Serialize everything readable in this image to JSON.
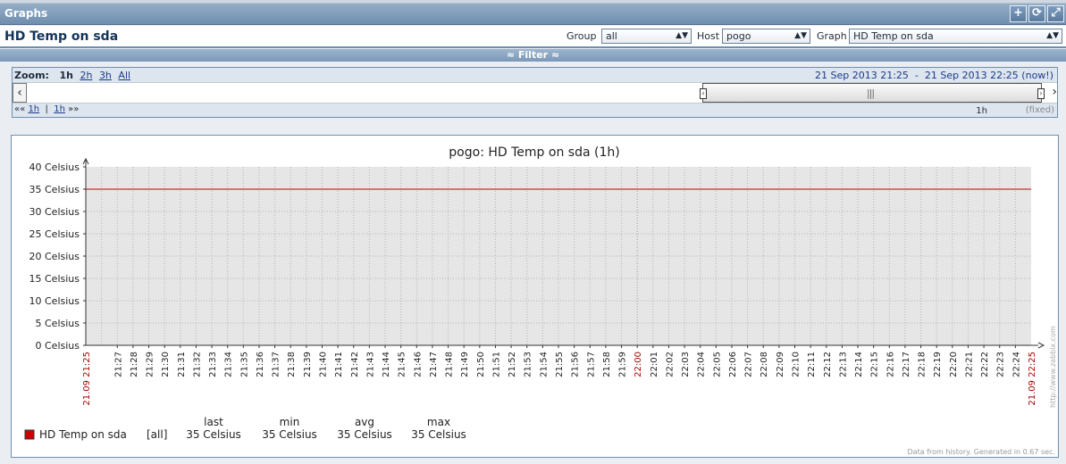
{
  "header": {
    "title": "Graphs",
    "buttons": [
      {
        "name": "add-to-favourites-icon",
        "glyph": "+"
      },
      {
        "name": "refresh-icon",
        "glyph": "⟳"
      },
      {
        "name": "fullscreen-icon",
        "glyph": "⤢"
      }
    ]
  },
  "page_title": "HD Temp on sda",
  "filters": {
    "group_label": "Group",
    "group_value": "all",
    "host_label": "Host",
    "host_value": "pogo",
    "graph_label": "Graph",
    "graph_value": "HD Temp on sda"
  },
  "filter_bar": {
    "label": "Filter",
    "arrow": "≈"
  },
  "zoom": {
    "label": "Zoom:",
    "options": [
      "1h",
      "2h",
      "3h",
      "All"
    ],
    "selected": "1h",
    "range_start": "21 Sep 2013 21:25",
    "range_sep": "-",
    "range_end": "21 Sep 2013 22:25 (now!)",
    "nav_back": "««",
    "nav_back_step": "1h",
    "nav_sep": "|",
    "nav_fwd_step": "1h",
    "nav_fwd": "»»",
    "period": "1h",
    "fixed": "(fixed)"
  },
  "chart_data": {
    "type": "line",
    "title": "pogo: HD Temp on sda (1h)",
    "ylim": [
      0,
      40
    ],
    "y_ticks": [
      "0 Celsius",
      "5 Celsius",
      "10 Celsius",
      "15 Celsius",
      "20 Celsius",
      "25 Celsius",
      "30 Celsius",
      "35 Celsius",
      "40 Celsius"
    ],
    "y_tick_values": [
      0,
      5,
      10,
      15,
      20,
      25,
      30,
      35,
      40
    ],
    "x_start_label": "21.09 21:25",
    "x_end_label": "21.09 22:25",
    "x_minute_labels": [
      "21:27",
      "21:28",
      "21:29",
      "21:30",
      "21:31",
      "21:32",
      "21:33",
      "21:34",
      "21:35",
      "21:36",
      "21:37",
      "21:38",
      "21:39",
      "21:40",
      "21:41",
      "21:42",
      "21:43",
      "21:44",
      "21:45",
      "21:46",
      "21:47",
      "21:48",
      "21:49",
      "21:50",
      "21:51",
      "21:52",
      "21:53",
      "21:54",
      "21:55",
      "21:56",
      "21:57",
      "21:58",
      "21:59",
      "22:00",
      "22:01",
      "22:02",
      "22:03",
      "22:04",
      "22:05",
      "22:06",
      "22:07",
      "22:08",
      "22:09",
      "22:10",
      "22:11",
      "22:12",
      "22:13",
      "22:14",
      "22:15",
      "22:16",
      "22:17",
      "22:18",
      "22:19",
      "22:20",
      "22:21",
      "22:22",
      "22:23",
      "22:24"
    ],
    "series": [
      {
        "name": "HD Temp on sda",
        "color": "#cc0000",
        "values": [
          35,
          35
        ]
      }
    ],
    "grid": true,
    "legend": {
      "function": "[all]",
      "columns": [
        "last",
        "min",
        "avg",
        "max"
      ],
      "values": [
        "35 Celsius",
        "35 Celsius",
        "35 Celsius",
        "35 Celsius"
      ]
    },
    "watermark": "http://www.zabbix.com",
    "footer": "Data from history. Generated in 0.67 sec."
  }
}
